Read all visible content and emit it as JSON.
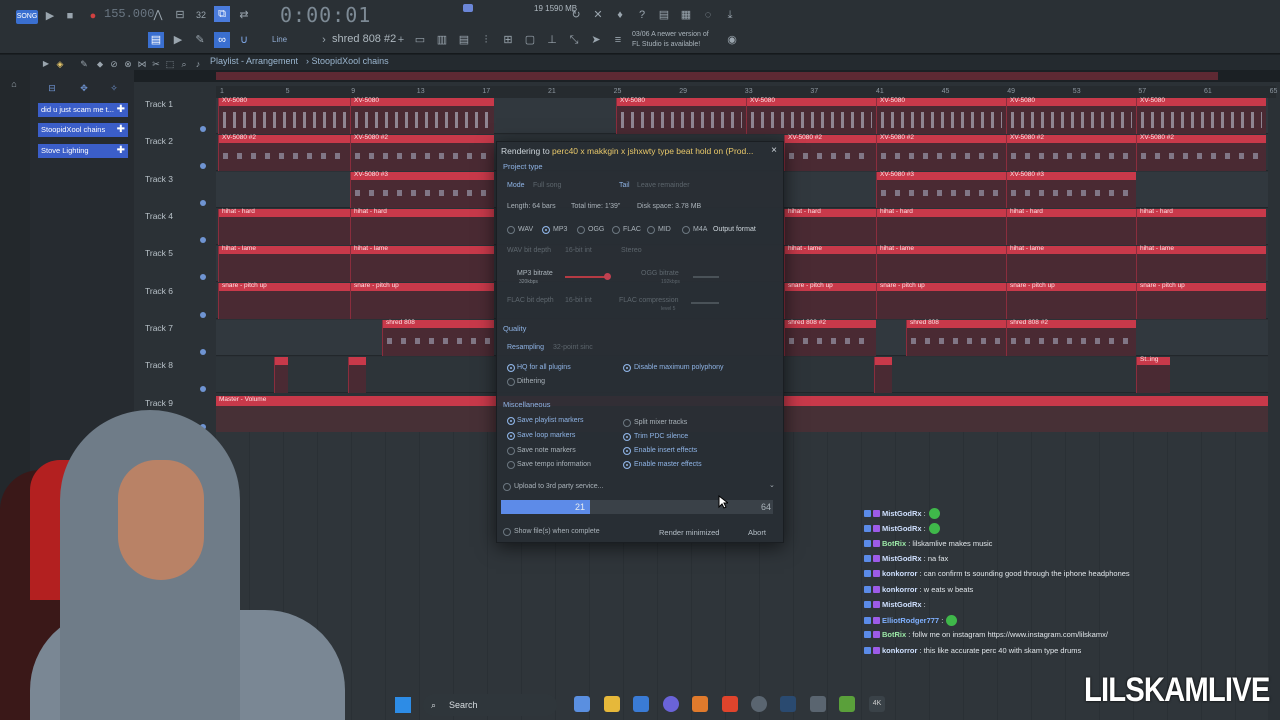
{
  "toolbar": {
    "song_badge": "SONG",
    "tempo": "155.000",
    "time": "0:00:01",
    "cpu_line": "19   1590 MB",
    "pattern": "shred 808 #2",
    "mode_line": "Line",
    "news_line1": "03/06  A newer version of",
    "news_line2": "FL Studio is available!"
  },
  "breadcrumb": {
    "window": "Playlist - Arrangement",
    "pattern": "StoopidXool chains"
  },
  "left_panel": {
    "items": [
      {
        "label": "did u just scam me t..."
      },
      {
        "label": "StoopidXool chains"
      },
      {
        "label": "Stove Lighting"
      }
    ]
  },
  "ruler": [
    "1",
    "5",
    "9",
    "13",
    "17",
    "21",
    "25",
    "29",
    "33",
    "37",
    "41",
    "45",
    "49",
    "53",
    "57",
    "61",
    "65"
  ],
  "tracks": [
    {
      "label": "Track 1"
    },
    {
      "label": "Track 2"
    },
    {
      "label": "Track 3"
    },
    {
      "label": "Track 4"
    },
    {
      "label": "Track 5"
    },
    {
      "label": "Track 6"
    },
    {
      "label": "Track 7"
    },
    {
      "label": "Track 8"
    },
    {
      "label": "Track 9"
    }
  ],
  "clips": {
    "xv5080": "XV-5080",
    "xv5080_2": "XV-5080 #2",
    "xv5080_3": "XV-5080 #3",
    "hihat_hard": "hihat - hard",
    "hihat_lame": "hihat - lame",
    "snare": "snare - pitch up",
    "shred808": "shred 808",
    "shred808_2": "shred 808 #2",
    "master": "Master - Volume",
    "sting": "St..ing"
  },
  "dialog": {
    "title_prefix": "Rendering to ",
    "title_file": "perc40 x makkgin x jshxwty type beat hold on (Prod...",
    "close": "×",
    "project_type": "Project type",
    "mode_label": "Mode",
    "mode_value": "Full song",
    "tail_label": "Tail",
    "tail_value": "Leave remainder",
    "length": "Length: 64 bars",
    "total_time": "Total time: 1'39\"",
    "disk_space": "Disk space: 3.78 MB",
    "formats": [
      "WAV",
      "MP3",
      "OGG",
      "FLAC",
      "MID",
      "M4A"
    ],
    "selected_format": "MP3",
    "output_format": "Output format",
    "wav_bit_depth": "WAV bit depth",
    "wav_bit_value": "16-bit int",
    "wav_stereo": "Stereo",
    "mp3_bitrate": "MP3 bitrate",
    "mp3_bitrate_value": "320kbps",
    "ogg_bitrate": "OGG bitrate",
    "ogg_bitrate_value": "192kbps",
    "flac_bit_depth": "FLAC bit depth",
    "flac_bit_value": "16-bit int",
    "flac_compression": "FLAC compression",
    "flac_compression_value": "level 5",
    "quality": "Quality",
    "resampling": "Resampling",
    "resampling_value": "32-point sinc",
    "hq_plugins": "HQ for all plugins",
    "disable_polyphony": "Disable maximum polyphony",
    "dithering": "Dithering",
    "misc": "Miscellaneous",
    "save_playlist_markers": "Save playlist markers",
    "split_mixer": "Split mixer tracks",
    "save_loop_markers": "Save loop markers",
    "trim_pdc": "Trim PDC silence",
    "save_note_markers": "Save note markers",
    "enable_insert": "Enable insert effects",
    "save_tempo": "Save tempo information",
    "enable_master": "Enable master effects",
    "upload": "Upload to 3rd party service...",
    "progress_current": "21",
    "progress_total": "64",
    "progress_fraction": 0.328,
    "show_files": "Show file(s) when complete",
    "render_minimized": "Render minimized",
    "abort": "Abort"
  },
  "chat": [
    {
      "user": "MistGodRx",
      "msg": " :",
      "color": "#cfe0ff",
      "emote": true
    },
    {
      "user": "MistGodRx",
      "msg": " :",
      "color": "#cfe0ff",
      "emote": true
    },
    {
      "user": "BotRix",
      "msg": " : lilskamlive makes music",
      "color": "#9be8a7",
      "emote": false
    },
    {
      "user": "MistGodRx",
      "msg": " : na fax",
      "color": "#cfe0ff",
      "emote": false
    },
    {
      "user": "konkorror",
      "msg": " : can confirm ts sounding good through the iphone headphones",
      "color": "#cfe0ff",
      "emote": false
    },
    {
      "user": "konkorror",
      "msg": " : w eats w beats",
      "color": "#cfe0ff",
      "emote": false
    },
    {
      "user": "MistGodRx",
      "msg": " :",
      "color": "#cfe0ff",
      "emote": false
    },
    {
      "user": "ElliotRodger777",
      "msg": " :",
      "color": "#7fb0ff",
      "emote": true
    },
    {
      "user": "BotRix",
      "msg": " : follw me on instagram https://www.instagram.com/lilskamx/",
      "color": "#9be8a7",
      "emote": false
    },
    {
      "user": "konkorror",
      "msg": " : this like accurate perc 40 with skam type drums",
      "color": "#cfe0ff",
      "emote": false
    }
  ],
  "taskbar": {
    "search": "Search"
  },
  "brand": "LILSKAMLIVE",
  "colors": {
    "accent": "#5d8be8",
    "clip_red": "#c8394a",
    "pl_item": "#3b5ec9"
  }
}
